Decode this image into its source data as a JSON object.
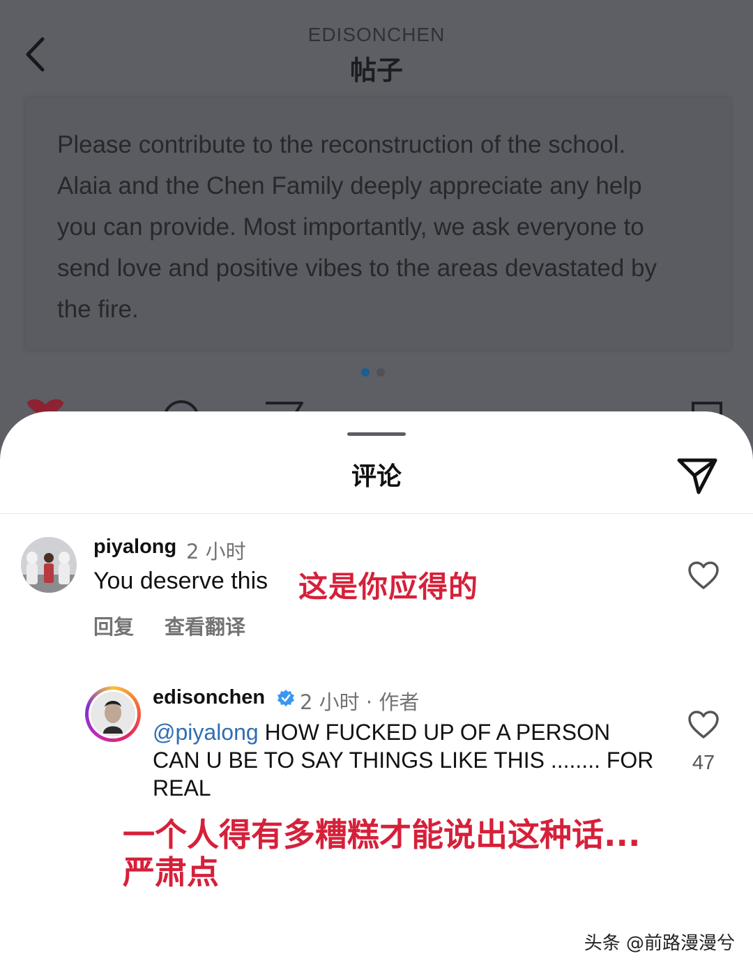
{
  "header": {
    "subtitle": "EDISONCHEN",
    "title": "帖子"
  },
  "post": {
    "text": "Please contribute to the reconstruction of the school. Alaia and the Chen Family deeply appreciate any help you can provide. Most importantly, we ask everyone to send love and positive vibes to the areas devastated by the fire.",
    "carousel_page": 1,
    "carousel_total": 2
  },
  "comments_sheet": {
    "title": "评论"
  },
  "comments": [
    {
      "username": "piyalong",
      "time": "2 小时",
      "text": "You deserve this",
      "annotation": "这是你应得的",
      "reply_label": "回复",
      "translate_label": "查看翻译"
    },
    {
      "username": "edisonchen",
      "time": "2 小时 · 作者",
      "mention": "@piyalong",
      "text": "HOW FUCKED UP OF A PERSON CAN U BE TO SAY THINGS LIKE THIS ........ FOR REAL",
      "like_count": "47",
      "annotation_line1": "一个人得有多糟糕才能说出这种话...",
      "annotation_line2": "严肃点"
    }
  ],
  "watermark": "头条 @前路漫漫兮",
  "colors": {
    "accent_red": "#d6203a",
    "mention_blue": "#2f6db3",
    "verified_blue": "#3897f0",
    "backdrop": "#5d5f64"
  }
}
